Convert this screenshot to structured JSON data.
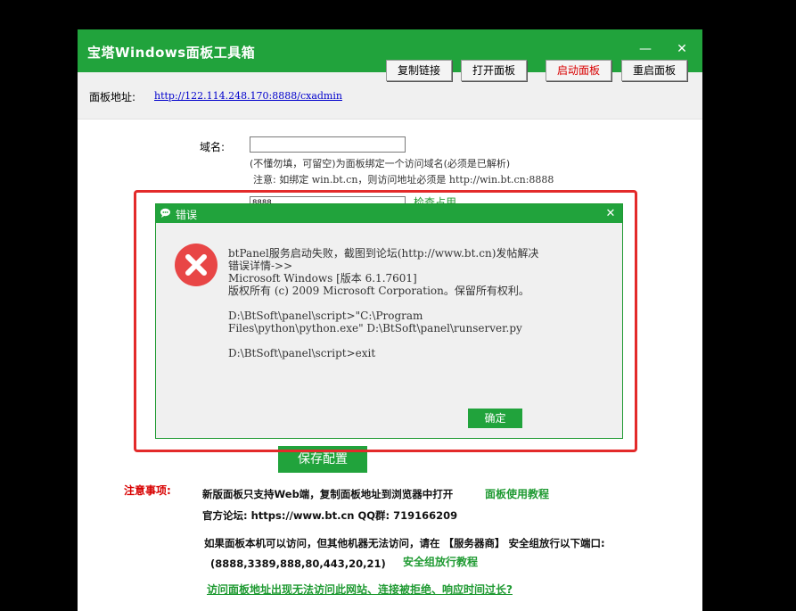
{
  "window": {
    "title": "宝塔Windows面板工具箱",
    "minimize": "—",
    "close": "✕"
  },
  "address": {
    "label": "面板地址:",
    "url": "http://122.114.248.170:8888/cxadmin"
  },
  "buttons": {
    "copy": "复制链接",
    "open": "打开面板",
    "start": "启动面板",
    "restart": "重启面板",
    "start_color": "#d80000"
  },
  "domain": {
    "label": "域名:",
    "value": "",
    "hint1": "(不懂勿填，可留空)为面板绑定一个访问域名(必须是已解析)",
    "hint2_prefix": "注意: 如绑定 ",
    "hint2_domain": "win.bt.cn",
    "hint2_mid": "，则访问地址必须是 ",
    "hint2_url": "http://win.bt.cn:8888"
  },
  "port": {
    "value": "8888",
    "check_link": "检查占用"
  },
  "save_button": "保存配置",
  "notices": {
    "heading": "注意事项:",
    "line1": "新版面板只支持Web端，复制面板地址到浏览器中打开",
    "line1_link": "面板使用教程",
    "line2": "官方论坛: https://www.bt.cn   QQ群: 719166209",
    "line3": "如果面板本机可以访问，但其他机器无法访问，请在 【服务器商】 安全组放行以下端口:",
    "line4": "(8888,3389,888,80,443,20,21)",
    "line4_link": "安全组放行教程",
    "line5_link": "访问面板地址出现无法访问此网站、连接被拒绝、响应时间过长?"
  },
  "dialog": {
    "title": "错误",
    "close": "✕",
    "icon": "error-x-icon",
    "message_lines": [
      "btPanel服务启动失败，截图到论坛(http://www.bt.cn)发帖解决",
      "错误详情->>",
      "Microsoft Windows [版本 6.1.7601]",
      "版权所有 (c) 2009 Microsoft Corporation。保留所有权利。",
      "",
      "D:\\BtSoft\\panel\\script>\"C:\\Program",
      "Files\\python\\python.exe\" D:\\BtSoft\\panel\\runserver.py",
      "",
      "D:\\BtSoft\\panel\\script>exit"
    ],
    "ok": "确定"
  },
  "colors": {
    "brand_green": "#21a33c",
    "annotation_red": "#e32a2a",
    "error_red": "#e84646"
  }
}
